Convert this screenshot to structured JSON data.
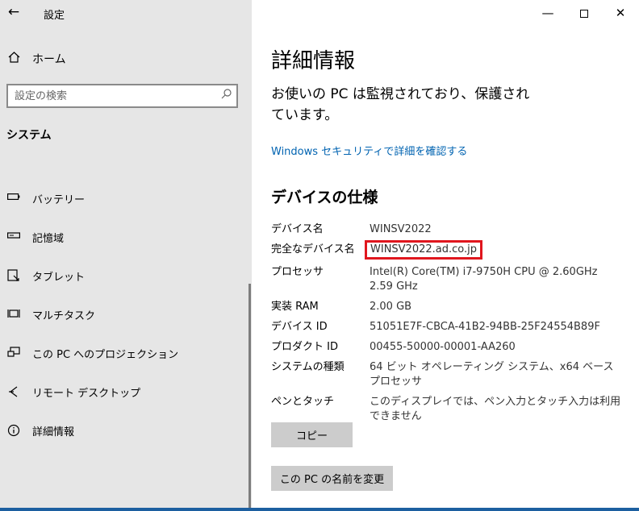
{
  "window": {
    "title": "設定",
    "back_glyph": "←",
    "minimize_glyph": "—",
    "close_glyph": "✕"
  },
  "sidebar": {
    "home_label": "ホーム",
    "search_placeholder": "設定の検索",
    "section_title": "システム",
    "items": [
      {
        "label": "バッテリー",
        "icon": "battery-icon"
      },
      {
        "label": "記憶域",
        "icon": "storage-icon"
      },
      {
        "label": "タブレット",
        "icon": "tablet-icon"
      },
      {
        "label": "マルチタスク",
        "icon": "multitasking-icon"
      },
      {
        "label": "この PC へのプロジェクション",
        "icon": "projection-icon"
      },
      {
        "label": "リモート デスクトップ",
        "icon": "remote-desktop-icon"
      },
      {
        "label": "詳細情報",
        "icon": "info-icon"
      }
    ]
  },
  "main": {
    "title": "詳細情報",
    "protection_text": "お使いの PC は監視されており、保護されています。",
    "security_link": "Windows セキュリティで詳細を確認する",
    "specs_title": "デバイスの仕様",
    "specs": [
      {
        "key": "デバイス名",
        "value": "WINSV2022"
      },
      {
        "key": "完全なデバイス名",
        "value": "WINSV2022.ad.co.jp"
      },
      {
        "key": "プロセッサ",
        "value": "Intel(R) Core(TM) i7-9750H CPU @ 2.60GHz   2.59 GHz"
      },
      {
        "key": "実装 RAM",
        "value": "2.00 GB"
      },
      {
        "key": "デバイス ID",
        "value": "51051E7F-CBCA-41B2-94BB-25F24554B89F"
      },
      {
        "key": "プロダクト ID",
        "value": "00455-50000-00001-AA260"
      },
      {
        "key": "システムの種類",
        "value": "64 ビット オペレーティング システム、x64 ベース プロセッサ"
      },
      {
        "key": "ペンとタッチ",
        "value": "このディスプレイでは、ペン入力とタッチ入力は利用できません"
      }
    ],
    "copy_label": "コピー",
    "rename_label": "この PC の名前を変更"
  },
  "colors": {
    "accent": "#0063b1",
    "highlight": "#e0161e",
    "sidebar_bg": "#e6e6e6"
  }
}
